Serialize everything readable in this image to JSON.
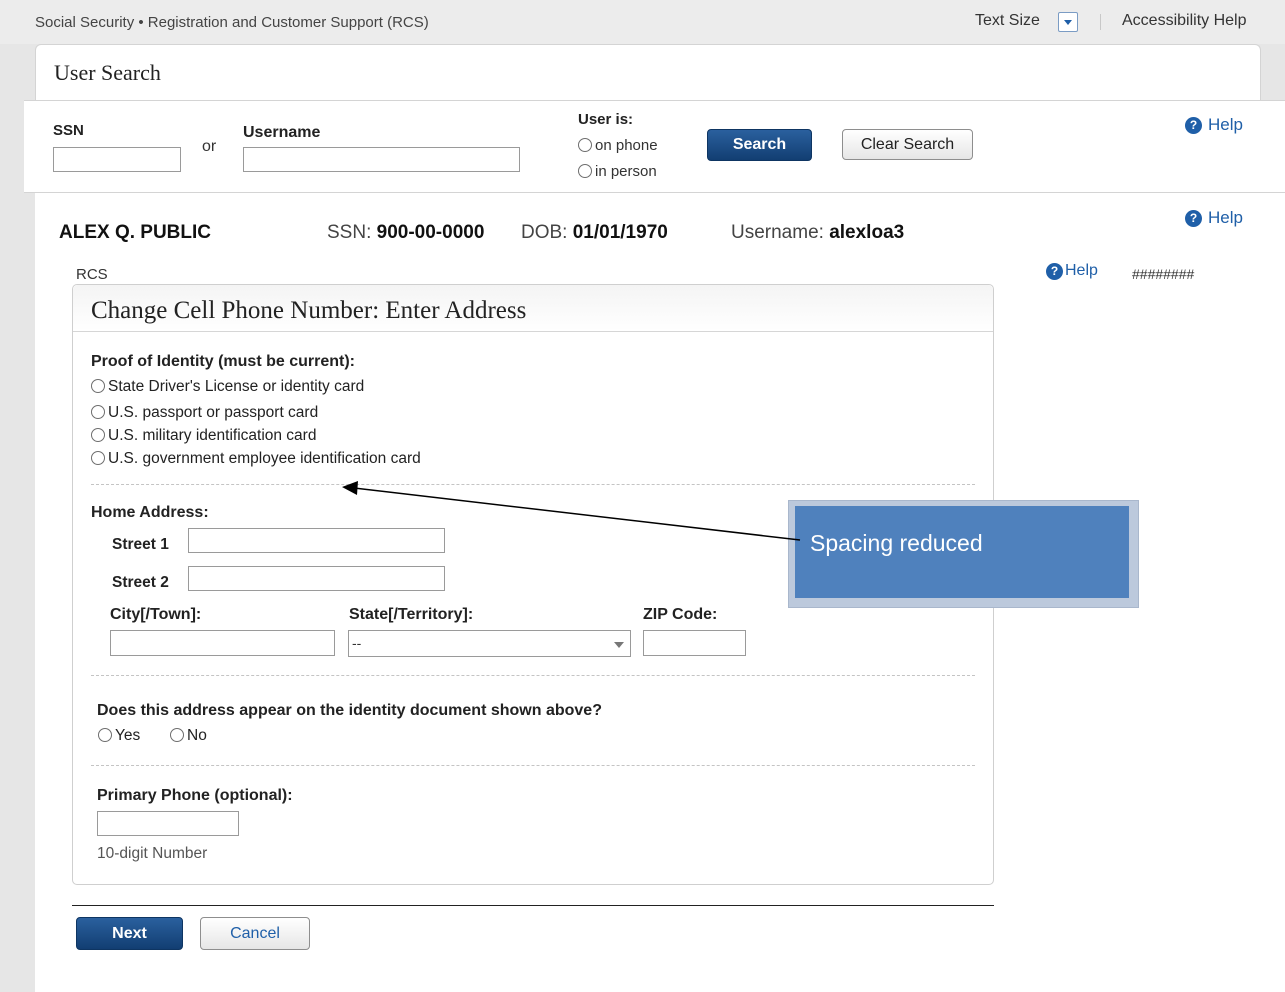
{
  "topbar": {
    "site_title": "Social Security • Registration and Customer Support (RCS)",
    "text_size_label": "Text Size",
    "accessibility_help": "Accessibility Help"
  },
  "page": {
    "title": "User Search"
  },
  "search": {
    "ssn_label": "SSN",
    "or_label": "or",
    "username_label": "Username",
    "user_is_label": "User is:",
    "options": [
      "on phone",
      "in person"
    ],
    "search_button": "Search",
    "clear_button": "Clear Search",
    "help": "Help",
    "help_icon_glyph": "?"
  },
  "person": {
    "name": "ALEX Q. PUBLIC",
    "ssn_label": "SSN:",
    "ssn": "900-00-0000",
    "dob_label": "DOB:",
    "dob": "01/01/1970",
    "username_label": "Username:",
    "username": "alexloa3",
    "help": "Help"
  },
  "rcs_label": "RCS",
  "panel_help": "Help",
  "hashes": "########",
  "form": {
    "title": "Change Cell Phone Number: Enter Address",
    "proof_label": "Proof of Identity (must be current):",
    "proof_options": [
      "State Driver's License or identity card",
      "U.S. passport or passport card",
      "U.S. military identification card",
      "U.S. government employee identification card"
    ],
    "home_address_label": "Home Address:",
    "street1_label": "Street 1",
    "street2_label": "Street 2",
    "city_label": "City[/Town]:",
    "state_label": "State[/Territory]:",
    "state_value": "--",
    "zip_label": "ZIP Code:",
    "address_question": "Does this address appear on the identity document shown above?",
    "yes_label": "Yes",
    "no_label": "No",
    "phone_label": "Primary Phone (optional):",
    "phone_hint": "10-digit Number"
  },
  "actions": {
    "next": "Next",
    "cancel": "Cancel"
  },
  "callout": {
    "text": "Spacing reduced"
  },
  "colors": {
    "primary": "#15467f",
    "link": "#1f5fa8",
    "callout": "#4f81bd"
  }
}
